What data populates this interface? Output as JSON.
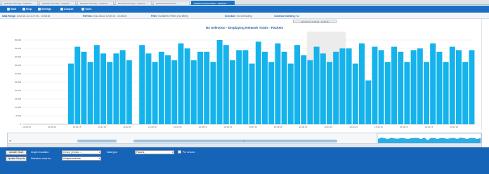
{
  "tabs": [
    {
      "label": "Network Summary - Instance ...",
      "active": false
    },
    {
      "label": "Network Summary - Instance ...",
      "active": false
    },
    {
      "label": "Network Summary - Instance ...",
      "active": false
    },
    {
      "label": "Network Summary - Instance ...",
      "active": false
    },
    {
      "label": "Network Performance ...",
      "active": false
    },
    {
      "label": "Capture Control Panel - Network ...",
      "active": true
    }
  ],
  "toolbar": {
    "start_label": "Start",
    "stop_label": "Stop",
    "settings_label": "Settings",
    "analyze_label": "Analyze",
    "tools_label": "Tools"
  },
  "info": {
    "data_range_label": "Data Range:",
    "data_range_value": "2012-06-11 10:27:00 - 10:48:15",
    "refresh_label": "Refresh:",
    "refresh_value": "2012-06-11 10:50:15 - 10:48:15",
    "filter_label": "Filter:",
    "filter_value": "Numbered Filters (No filters)",
    "schedule_label": "Schedule:",
    "schedule_value": "No scheduling",
    "continuous_label": "Continue Indexing:",
    "continuous_value": "No"
  },
  "chart_data": {
    "type": "bar",
    "title": "No Selection - Displaying Network Totals - Packets",
    "range_box": "2012-06-11 10:48:15 - 10:48:15",
    "ylim": [
      0,
      55000
    ],
    "y_ticks": [
      "0",
      "5,000",
      "10,000",
      "15,000",
      "20,000",
      "25,000",
      "30,000",
      "35,000",
      "40,000",
      "45,000",
      "50,000"
    ],
    "x_ticks": [
      "10:28:15",
      "10:29:15",
      "10:30:15",
      "10:31:15",
      "10:32:15",
      "10:33:15",
      "10:34:15",
      "10:35:15",
      "10:36:15",
      "10:37:15",
      "10:38:15",
      "10:39:15",
      "10:40:15",
      "10:41:15",
      "10:42:15",
      "10:43:15",
      "10:44:15",
      "10:45:15"
    ],
    "values": [
      0,
      0,
      0,
      0,
      0,
      0,
      0,
      36000,
      46000,
      43000,
      37000,
      47000,
      42000,
      37000,
      42000,
      44000,
      38000,
      0,
      47000,
      42000,
      37000,
      43000,
      41000,
      38000,
      48000,
      45000,
      38000,
      43000,
      43000,
      37000,
      50000,
      47000,
      38000,
      44000,
      44000,
      36000,
      49000,
      43000,
      37000,
      48000,
      43000,
      36000,
      47000,
      41000,
      38000,
      46000,
      42000,
      37000,
      43000,
      45000,
      45000,
      36000,
      48000,
      26000,
      46000,
      44000,
      37000,
      46000,
      43000,
      37000,
      44000,
      45000,
      37000,
      48000,
      43000,
      37000,
      46000,
      44000,
      37000,
      44000
    ],
    "highlight_range": [
      44,
      50
    ],
    "bar_color": "#15b3ec",
    "grid": true
  },
  "bottom": {
    "update_chart_label": "Update Chart",
    "update_reports_label": "Update Reports",
    "resolution_label": "Graph resolution:",
    "resolution_value": "15 sec. | 15 sec. ...",
    "data_type_label": "Data type:",
    "data_type_value": "Packets",
    "per_second_label": "Per second",
    "selection_label": "Selection mode for:",
    "selection_value": "Analysis selection"
  }
}
